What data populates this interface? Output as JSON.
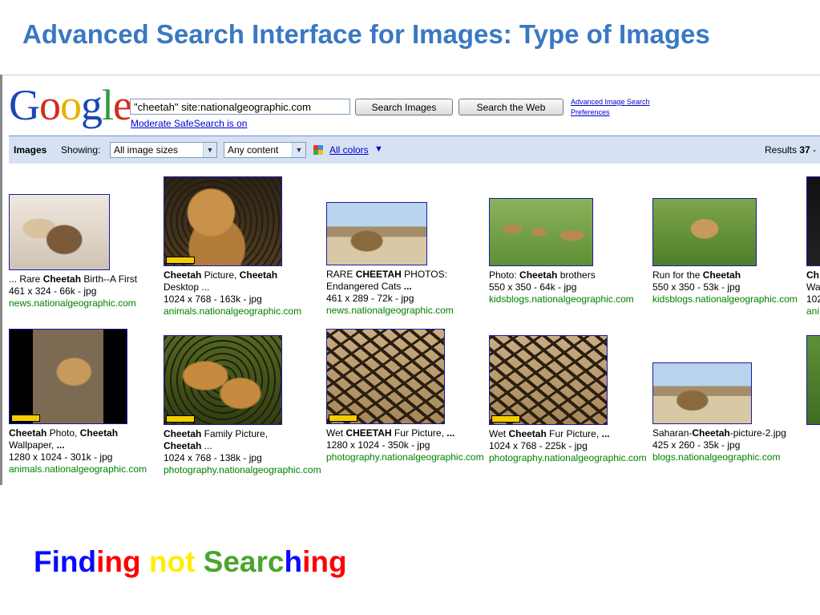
{
  "slide": {
    "title": "Advanced Search Interface for Images: Type of Images",
    "tagline": [
      {
        "text": "Find",
        "color": "#0a0aff"
      },
      {
        "text": "ing",
        "color": "#ff0000"
      },
      {
        "text": " ",
        "color": "#000000"
      },
      {
        "text": "not",
        "color": "#ffee00"
      },
      {
        "text": " ",
        "color": "#000000"
      },
      {
        "text": "Searc",
        "color": "#4aa52e"
      },
      {
        "text": "h",
        "color": "#0a0aff"
      },
      {
        "text": "ing",
        "color": "#ff0000"
      }
    ]
  },
  "logo": {
    "letters": [
      {
        "ch": "G",
        "color": "#1a47b8"
      },
      {
        "ch": "o",
        "color": "#d42b1e"
      },
      {
        "ch": "o",
        "color": "#e8b000"
      },
      {
        "ch": "g",
        "color": "#1a47b8"
      },
      {
        "ch": "l",
        "color": "#2f9a3c"
      },
      {
        "ch": "e",
        "color": "#d42b1e"
      }
    ]
  },
  "search": {
    "query": "\"cheetah\" site:nationalgeographic.com",
    "search_images_label": "Search Images",
    "search_web_label": "Search the Web",
    "advanced_link": "Advanced Image Search",
    "preferences_link": "Preferences",
    "safesearch_link": "Moderate SafeSearch is on"
  },
  "toolbar": {
    "images_label": "Images",
    "showing_label": "Showing:",
    "size_filter": "All image sizes",
    "content_filter": "Any content",
    "colors_link": "All colors",
    "colors_caret": "▼",
    "results_prefix": "Results ",
    "results_count": "37",
    "results_suffix": " -"
  },
  "results": [
    {
      "title": [
        "... Rare ",
        {
          "b": "Cheetah"
        },
        " Birth--A First"
      ],
      "meta": "461 x 324 - 66k - jpg",
      "site": "news.nationalgeographic.com",
      "scene": "cub"
    },
    {
      "title": [
        {
          "b": "Cheetah"
        },
        " Picture, ",
        {
          "b": "Cheetah"
        }
      ],
      "title2": [
        "Desktop ..."
      ],
      "meta": "1024 x 768 - 163k - jpg",
      "site": "animals.nationalgeographic.com",
      "scene": "portrait"
    },
    {
      "title": [
        "RARE ",
        {
          "b": "CHEETAH"
        },
        " PHOTOS:"
      ],
      "title2": [
        "Endangered Cats ",
        {
          "b": "..."
        }
      ],
      "meta": "461 x 289 - 72k - jpg",
      "site": "news.nationalgeographic.com",
      "scene": "savanna"
    },
    {
      "title": [
        "Photo: ",
        {
          "b": "Cheetah"
        },
        " brothers"
      ],
      "meta": "550 x 350 - 64k - jpg",
      "site": "kidsblogs.nationalgeographic.com",
      "scene": "grass"
    },
    {
      "title": [
        "Run for the ",
        {
          "b": "Cheetah"
        }
      ],
      "meta": "550 x 350 - 53k - jpg",
      "site": "kidsblogs.nationalgeographic.com",
      "scene": "run"
    },
    {
      "title": [
        {
          "b": "Ch"
        }
      ],
      "meta": "102",
      "site": "ani",
      "line2": "Wa",
      "scene": "dark"
    },
    {
      "title": [
        {
          "b": "Cheetah"
        },
        " Photo, ",
        {
          "b": "Cheetah"
        }
      ],
      "title2": [
        "Wallpaper, ",
        {
          "b": "..."
        }
      ],
      "meta": "1280 x 1024 - 301k - jpg",
      "site": "animals.nationalgeographic.com",
      "scene": "leap"
    },
    {
      "title": [
        {
          "b": "Cheetah"
        },
        " Family Picture,"
      ],
      "title2": [
        {
          "b": "Cheetah"
        },
        " ..."
      ],
      "meta": "1024 x 768 - 138k - jpg",
      "site": "photography.nationalgeographic.com",
      "scene": "family"
    },
    {
      "title": [
        "Wet ",
        {
          "b": "CHEETAH"
        },
        " Fur Picture, ",
        {
          "b": "..."
        }
      ],
      "meta": "1280 x 1024 - 350k - jpg",
      "site": "photography.nationalgeographic.com",
      "scene": "fur"
    },
    {
      "title": [
        "Wet ",
        {
          "b": "Cheetah"
        },
        " Fur Picture, ",
        {
          "b": "..."
        }
      ],
      "meta": "1024 x 768 - 225k - jpg",
      "site": "photography.nationalgeographic.com",
      "scene": "fur"
    },
    {
      "title": [
        "Saharan-",
        {
          "b": "Cheetah"
        },
        "-picture-2.jpg"
      ],
      "meta": "425 x 260 - 35k - jpg",
      "site": "blogs.nationalgeographic.com",
      "scene": "savanna"
    },
    {
      "title": [],
      "meta": "",
      "site": "",
      "scene": "green"
    }
  ]
}
